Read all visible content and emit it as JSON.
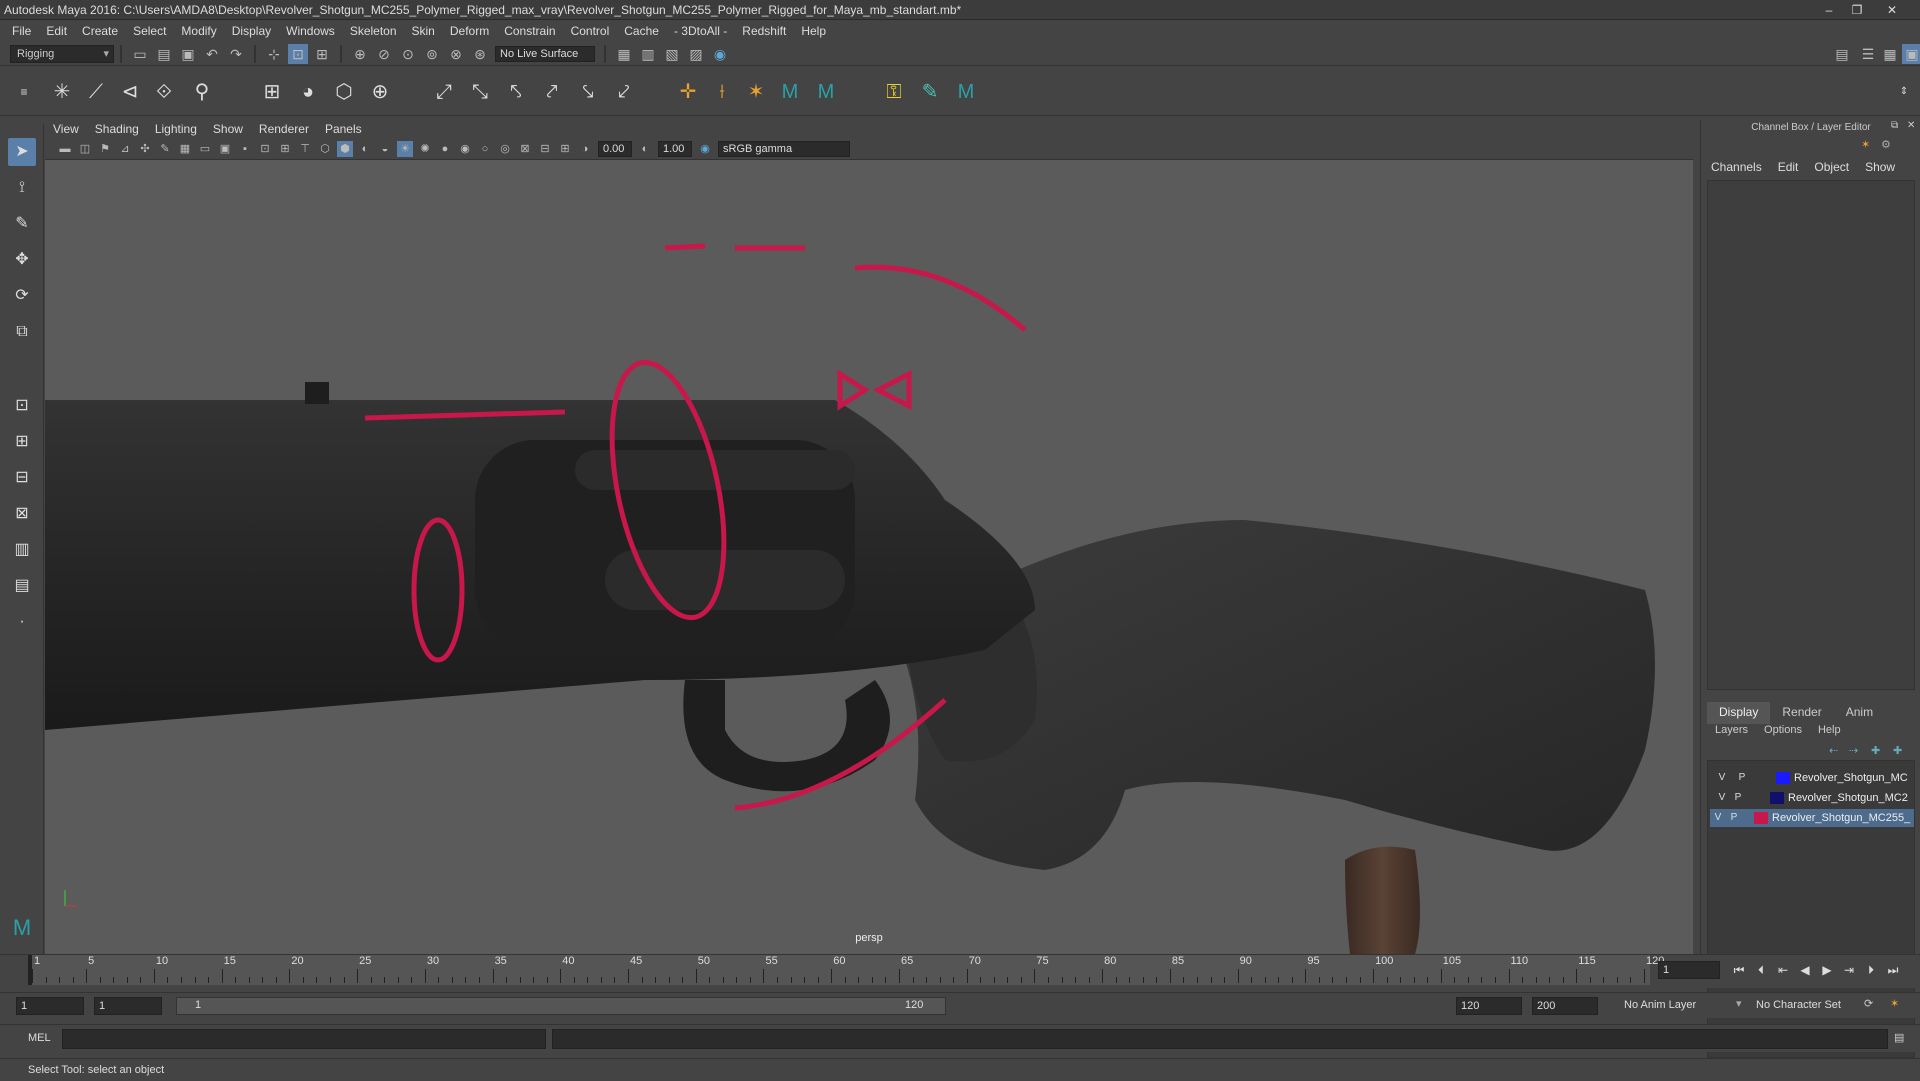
{
  "window": {
    "title": "Autodesk Maya 2016: C:\\Users\\AMDA8\\Desktop\\Revolver_Shotgun_MC255_Polymer_Rigged_max_vray\\Revolver_Shotgun_MC255_Polymer_Rigged_for_Maya_mb_standart.mb*"
  },
  "menubar": [
    "File",
    "Edit",
    "Create",
    "Select",
    "Modify",
    "Display",
    "Windows",
    "Skeleton",
    "Skin",
    "Deform",
    "Constrain",
    "Control",
    "Cache",
    "- 3DtoAll -",
    "Redshift",
    "Help"
  ],
  "statusline": {
    "menuset": "Rigging",
    "live_surface": "No Live Surface"
  },
  "viewport": {
    "menu": [
      "View",
      "Shading",
      "Lighting",
      "Show",
      "Renderer",
      "Panels"
    ],
    "exposure": "0.00",
    "gamma": "1.00",
    "colorspace": "sRGB gamma",
    "camera_label": "persp"
  },
  "channelbox": {
    "title": "Channel Box / Layer Editor",
    "tabs": [
      "Channels",
      "Edit",
      "Object",
      "Show"
    ]
  },
  "layers": {
    "tabs": [
      "Display",
      "Render",
      "Anim"
    ],
    "menu": [
      "Layers",
      "Options",
      "Help"
    ],
    "rows": [
      {
        "v": "V",
        "p": "P",
        "name": "Revolver_Shotgun_MC",
        "color": "#1a1aff",
        "selected": false
      },
      {
        "v": "V",
        "p": "P",
        "name": "Revolver_Shotgun_MC2",
        "color": "#10106a",
        "selected": false
      },
      {
        "v": "V",
        "p": "P",
        "name": "Revolver_Shotgun_MC255_",
        "color": "#c8174a",
        "selected": true
      }
    ]
  },
  "timeline": {
    "ticks": [
      "1",
      "5",
      "10",
      "15",
      "20",
      "25",
      "30",
      "35",
      "40",
      "45",
      "50",
      "55",
      "60",
      "65",
      "70",
      "75",
      "80",
      "85",
      "90",
      "95",
      "100",
      "105",
      "110",
      "115",
      "120"
    ],
    "current_frame": "1"
  },
  "range": {
    "start": "1",
    "inner_start": "1",
    "slider_start": "1",
    "slider_end": "120",
    "end": "120",
    "outer_end": "200",
    "anim_layer": "No Anim Layer",
    "character_set": "No Character Set"
  },
  "cmdline": {
    "label": "MEL"
  },
  "helpline": {
    "text": "Select Tool: select an object"
  },
  "colors": {
    "accent": "#5a7fa8",
    "rig_controls": "#c8174a"
  }
}
